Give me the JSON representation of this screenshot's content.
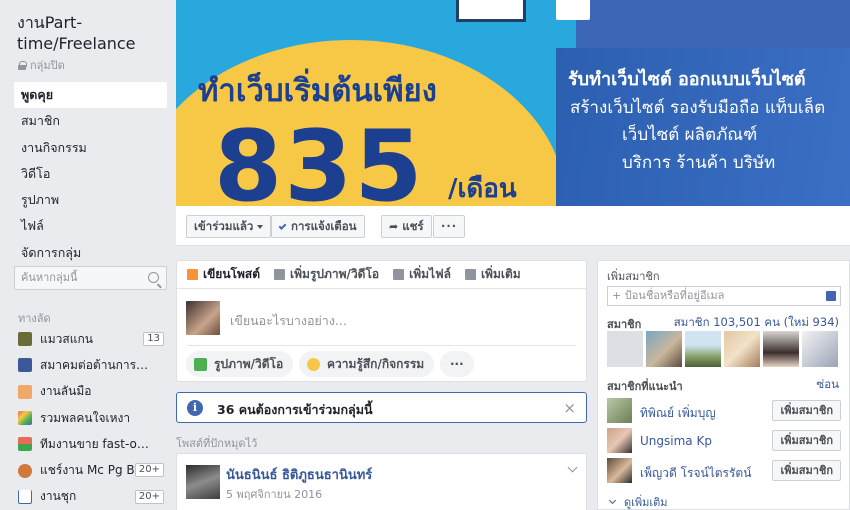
{
  "group": {
    "title": "งานPart-time/Freelance",
    "privacy": "กลุ่มปิด"
  },
  "nav": [
    {
      "label": "พูดคุย"
    },
    {
      "label": "สมาชิก"
    },
    {
      "label": "งานกิจกรรม"
    },
    {
      "label": "วิดีโอ"
    },
    {
      "label": "รูปภาพ"
    },
    {
      "label": "ไฟล์"
    },
    {
      "label": "จัดการกลุ่ม"
    }
  ],
  "search": {
    "placeholder": "ค้นหากลุ่มนี้"
  },
  "shortcuts": {
    "header": "ทางลัด",
    "items": [
      {
        "label": "แมวสแกน",
        "badge": "13",
        "color": "#6b6b3a"
      },
      {
        "label": "สมาคมต่อต้านการหลอ...",
        "badge": "",
        "color": "#3b5998"
      },
      {
        "label": "งานลันมือ",
        "badge": "",
        "color": "#f0a868"
      },
      {
        "label": "รวมพลคนใจเหงา",
        "badge": "",
        "color": "#e86a5a"
      },
      {
        "label": "ทีมงานขาย fast-online",
        "badge": "",
        "color": "#3aa84a"
      },
      {
        "label": "แชร์งาน Mc Pg B...",
        "badge": "20+",
        "color": "#d2783c"
      },
      {
        "label": "งานชุก",
        "badge": "20+",
        "color": "#4267b2"
      }
    ]
  },
  "cover": {
    "headline": "ทำเว็บเริ่มต้นเพียง",
    "price": "835",
    "unit": "/เดือน",
    "line1": "รับทำเว็บไซต์ ออกแบบเว็บไซต์",
    "line2": "สร้างเว็บไซต์ รองรับมือถือ แท็บเล็ต",
    "line3": "เว็บไซต์ ผลิตภัณฑ์",
    "line4": "บริการ ร้านค้า บริษัท"
  },
  "actions": {
    "joined": "เข้าร่วมแล้ว",
    "notifications": "การแจ้งเตือน",
    "share": "แชร์",
    "more": "···"
  },
  "composer": {
    "tabs": [
      {
        "label": "เขียนโพสต์",
        "icon": "pencil-icon",
        "color": "#f7923b"
      },
      {
        "label": "เพิ่มรูปภาพ/วิดีโอ",
        "icon": "camera-icon",
        "color": "#90949c"
      },
      {
        "label": "เพิ่มไฟล์",
        "icon": "file-icon",
        "color": "#90949c"
      },
      {
        "label": "เพิ่มเติม",
        "icon": "more-icon",
        "color": "#90949c"
      }
    ],
    "placeholder": "เขียนอะไรบางอย่าง...",
    "photo_pill": "รูปภาพ/วิดีโอ",
    "feeling_pill": "ความรู้สึก/กิจกรรม",
    "more_pill": "···"
  },
  "notice": {
    "text": "36 คนต้องการเข้าร่วมกลุ่มนี้",
    "close": "×"
  },
  "pinned": {
    "label": "โพสต์ที่ปักหมุดไว้",
    "author": "นันธนินธ์ ธิติภูธนธานินทร์",
    "date": "5 พฤศจิกายน 2016"
  },
  "right": {
    "add_members_header": "เพิ่มสมาชิก",
    "add_placeholder": "+ ป้อนชื่อหรือที่อยู่อีเมล",
    "members_header": "สมาชิก",
    "members_count": "สมาชิก 103,501 คน (ใหม่ 934)",
    "suggested_header": "สมาชิกที่แนะนำ",
    "hide_link": "ซ่อน",
    "suggestions": [
      {
        "name": "ทิพิณย์ เพิ่มบุญ",
        "button": "เพิ่มสมาชิก"
      },
      {
        "name": "Ungsima Kp",
        "button": "เพิ่มสมาชิก"
      },
      {
        "name": "เพ็ญวดี โรจน์ไตรรัตน์",
        "button": "เพิ่มสมาชิก"
      }
    ],
    "see_more": "ดูเพิ่มเติม"
  }
}
